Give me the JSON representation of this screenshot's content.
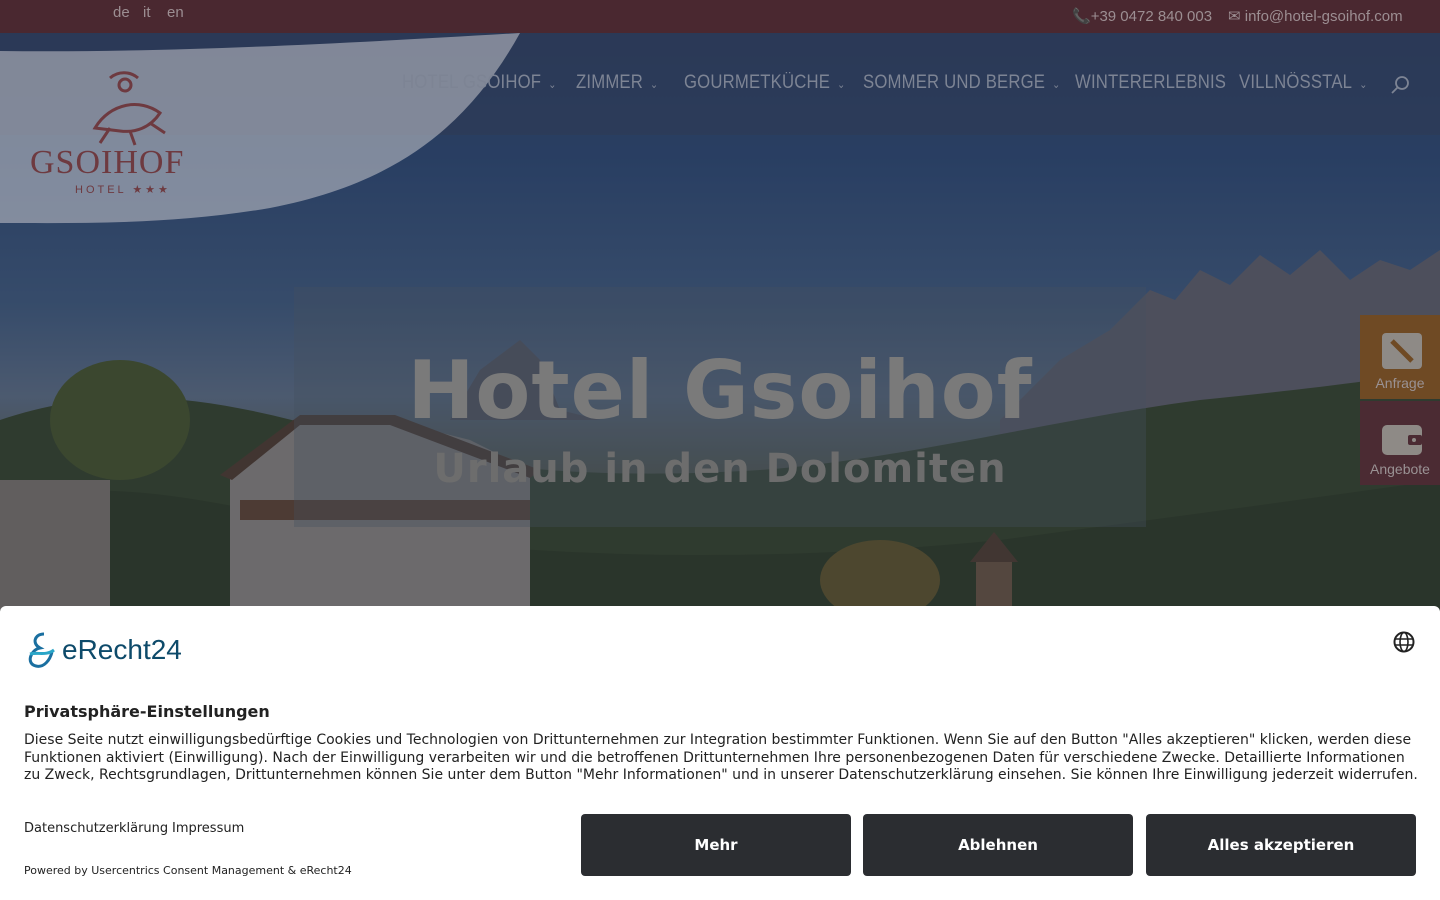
{
  "languages": [
    "de",
    "it",
    "en"
  ],
  "contact": {
    "phone": "+39 0472 840 003",
    "email": "info@hotel-gsoihof.com",
    "phone_icon": "phone-icon",
    "email_icon": "envelope-icon"
  },
  "logo": {
    "name": "GSOIHOF",
    "sub": "HOTEL ★★★"
  },
  "nav": {
    "items": [
      {
        "label": "HOTEL GSOIHOF",
        "has_submenu": true
      },
      {
        "label": "ZIMMER",
        "has_submenu": true
      },
      {
        "label": "GOURMETKÜCHE",
        "has_submenu": true
      },
      {
        "label": "SOMMER UND BERGE",
        "has_submenu": true
      },
      {
        "label": "WINTERERLEBNIS",
        "has_submenu": false
      },
      {
        "label": "VILLNÖSSTAL",
        "has_submenu": true
      }
    ],
    "search_icon": "search-icon"
  },
  "hero": {
    "title": "Hotel Gsoihof",
    "subtitle": "Urlaub in den Dolomiten"
  },
  "side_tabs": [
    {
      "label": "Anfrage",
      "icon": "pencil-icon"
    },
    {
      "label": "Angebote",
      "icon": "wallet-icon"
    }
  ],
  "consent": {
    "brand": "eRecht24",
    "title": "Privatsphäre-Einstellungen",
    "text": "Diese Seite nutzt einwilligungsbedürftige Cookies und Technologien von Drittunternehmen zur Integration bestimmter Funktionen. Wenn Sie auf den Button \"Alles akzeptieren\" klicken, werden diese Funktionen aktiviert (Einwilligung). Nach der Einwilligung verarbeiten wir und die betroffenen Drittunternehmen Ihre personenbezogenen Daten für verschiedene Zwecke. Detaillierte Informationen zu Zweck, Rechtsgrundlagen, Drittunternehmen können Sie unter dem Button \"Mehr Informationen\" und in unserer Datenschutzerklärung einsehen. Sie können Ihre Einwilligung jederzeit widerrufen.",
    "links": [
      "Datenschutzerklärung",
      "Impressum"
    ],
    "powered_by": "Powered by Usercentrics Consent Management & eRecht24",
    "buttons": {
      "more": "Mehr",
      "deny": "Ablehnen",
      "accept": "Alles akzeptieren"
    },
    "language_icon": "globe-icon"
  },
  "colors": {
    "topbar": "#4a2830",
    "brand_red": "#7a2a35",
    "button_dark": "#2b2d31",
    "anfrage_tab": "#6f4a24",
    "angebote_tab": "#4b2b33"
  }
}
